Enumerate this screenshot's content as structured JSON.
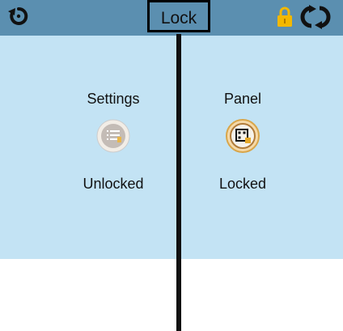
{
  "header": {
    "title": "Lock",
    "back_icon": "back-arrow-icon",
    "lock_icon": "padlock-icon",
    "refresh_icon": "refresh-icon",
    "bar_color": "#5b8fb0",
    "lock_color": "#f3b800"
  },
  "content": {
    "background": "#c3e3f4",
    "items": [
      {
        "label": "Settings",
        "status": "Unlocked",
        "icon": "settings-list-icon"
      },
      {
        "label": "Panel",
        "status": "Locked",
        "icon": "panel-grid-icon"
      }
    ]
  }
}
